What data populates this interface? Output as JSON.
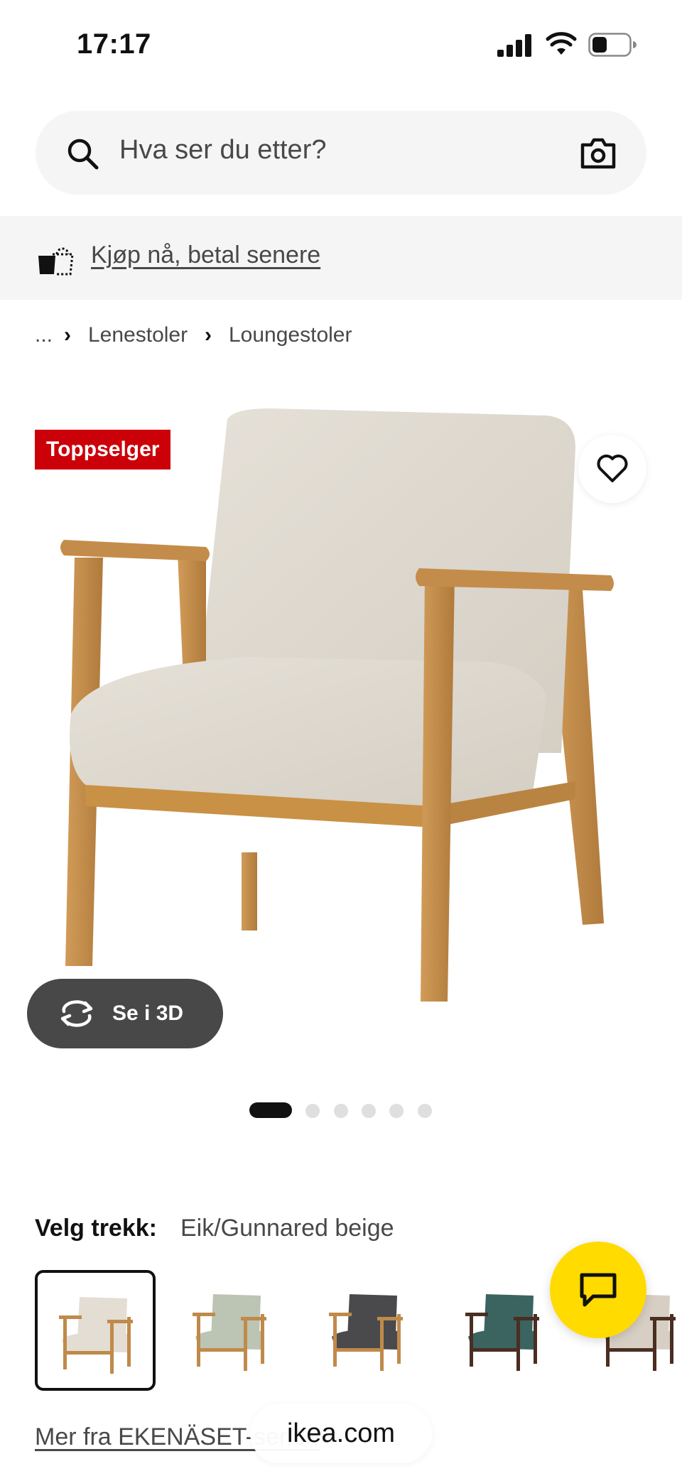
{
  "status_bar": {
    "time": "17:17"
  },
  "search": {
    "placeholder": "Hva ser du etter?"
  },
  "banner": {
    "text": "Kjøp nå, betal senere"
  },
  "breadcrumb": {
    "ellipsis": "...",
    "items": [
      "Lenestoler",
      "Loungestoler"
    ]
  },
  "product": {
    "badge": "Toppselger",
    "view_3d_label": "Se i 3D",
    "image_pager": {
      "count": 6,
      "active_index": 0
    }
  },
  "variant": {
    "label": "Velg trekk:",
    "value": "Eik/Gunnared beige",
    "swatches": [
      {
        "name": "Eik/Gunnared beige",
        "fabric": "#e3ddd3",
        "wood": "#c08a4a",
        "selected": true
      },
      {
        "name": "sage",
        "fabric": "#bcc4b4",
        "wood": "#c08a4a"
      },
      {
        "name": "dark grey",
        "fabric": "#4a4a4c",
        "wood": "#c08a4a"
      },
      {
        "name": "green-blue",
        "fabric": "#3b6460",
        "wood": "#4a2e22"
      },
      {
        "name": "beige-brown",
        "fabric": "#d8cfc4",
        "wood": "#4a2e22"
      }
    ]
  },
  "more_link": "Mer fra EKENÄSET-serien",
  "browser": {
    "domain": "ikea.com"
  },
  "colors": {
    "badge": "#cc0008",
    "chat_button": "#ffdb00"
  }
}
